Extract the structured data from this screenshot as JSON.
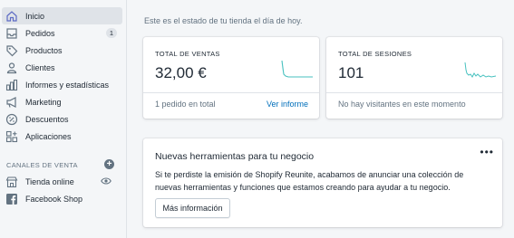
{
  "sidebar": {
    "items": [
      {
        "label": "Inicio",
        "icon": "home-icon",
        "active": true
      },
      {
        "label": "Pedidos",
        "icon": "orders-icon",
        "badge": "1"
      },
      {
        "label": "Productos",
        "icon": "tag-icon"
      },
      {
        "label": "Clientes",
        "icon": "person-icon"
      },
      {
        "label": "Informes y estadísticas",
        "icon": "bar-chart-icon"
      },
      {
        "label": "Marketing",
        "icon": "megaphone-icon"
      },
      {
        "label": "Descuentos",
        "icon": "discount-icon"
      },
      {
        "label": "Aplicaciones",
        "icon": "apps-icon"
      }
    ],
    "channels_label": "CANALES DE VENTA",
    "channels": [
      {
        "label": "Tienda online",
        "icon": "store-icon"
      },
      {
        "label": "Facebook Shop",
        "icon": "facebook-icon"
      }
    ]
  },
  "main": {
    "intro": "Este es el estado de tu tienda el día de hoy.",
    "sales_card": {
      "title": "TOTAL DE VENTAS",
      "value": "32,00 €",
      "footer": "1 pedido en total",
      "link": "Ver informe"
    },
    "sessions_card": {
      "title": "TOTAL DE SESIONES",
      "value": "101",
      "footer": "No hay visitantes en este momento"
    },
    "news_card": {
      "title": "Nuevas herramientas para tu negocio",
      "body": "Si te perdiste la emisión de Shopify Reunite, acabamos de anunciar una colección de nuevas herramientas y funciones que estamos creando para ayudar a tu negocio.",
      "button": "Más información",
      "menu": "•••"
    }
  },
  "colors": {
    "sparkline": "#47c1bf",
    "link": "#006fbb",
    "icon": "#637381"
  }
}
